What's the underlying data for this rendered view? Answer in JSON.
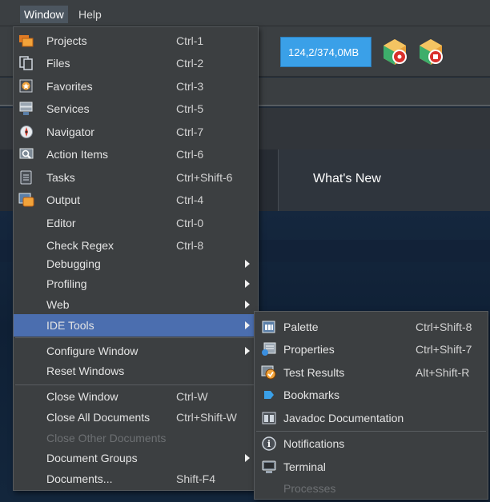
{
  "menubar": {
    "items": [
      {
        "label": "Window",
        "active": true
      },
      {
        "label": "Help",
        "active": false
      }
    ]
  },
  "toolbar": {
    "memory_label": "124,2/374,0MB",
    "profile_icons": [
      "profile-ide-icon",
      "profile-snapshot-icon"
    ]
  },
  "editor": {
    "whats_new_tab": "What's New"
  },
  "window_menu": {
    "items": [
      {
        "label": "Projects",
        "shortcut": "Ctrl-1",
        "icon": "projects-icon"
      },
      {
        "label": "Files",
        "shortcut": "Ctrl-2",
        "icon": "files-icon"
      },
      {
        "label": "Favorites",
        "shortcut": "Ctrl-3",
        "icon": "favorites-icon"
      },
      {
        "label": "Services",
        "shortcut": "Ctrl-5",
        "icon": "services-icon"
      },
      {
        "label": "Navigator",
        "shortcut": "Ctrl-7",
        "icon": "navigator-icon"
      },
      {
        "label": "Action Items",
        "shortcut": "Ctrl-6",
        "icon": "action-items-icon"
      },
      {
        "label": "Tasks",
        "shortcut": "Ctrl+Shift-6",
        "icon": "tasks-icon"
      },
      {
        "label": "Output",
        "shortcut": "Ctrl-4",
        "icon": "output-icon"
      },
      {
        "label": "Editor",
        "shortcut": "Ctrl-0"
      },
      {
        "label": "Check Regex",
        "shortcut": "Ctrl-8"
      },
      {
        "label": "Debugging",
        "submenu": true
      },
      {
        "label": "Profiling",
        "submenu": true
      },
      {
        "label": "Web",
        "submenu": true
      },
      {
        "label": "IDE Tools",
        "submenu": true,
        "selected": true
      },
      {
        "label": "Configure Window",
        "submenu": true
      },
      {
        "label": "Reset Windows"
      },
      {
        "label": "Close Window",
        "shortcut": "Ctrl-W"
      },
      {
        "label": "Close All Documents",
        "shortcut": "Ctrl+Shift-W"
      },
      {
        "label": "Close Other Documents",
        "disabled": true
      },
      {
        "label": "Document Groups",
        "submenu": true
      },
      {
        "label": "Documents...",
        "shortcut": "Shift-F4"
      }
    ]
  },
  "ide_tools_menu": {
    "items": [
      {
        "label": "Palette",
        "shortcut": "Ctrl+Shift-8",
        "icon": "palette-icon"
      },
      {
        "label": "Properties",
        "shortcut": "Ctrl+Shift-7",
        "icon": "properties-icon"
      },
      {
        "label": "Test Results",
        "shortcut": "Alt+Shift-R",
        "icon": "test-results-icon"
      },
      {
        "label": "Bookmarks",
        "icon": "bookmarks-icon"
      },
      {
        "label": "Javadoc Documentation",
        "icon": "javadoc-icon"
      },
      {
        "label": "Notifications",
        "icon": "notifications-icon"
      },
      {
        "label": "Terminal",
        "icon": "terminal-icon"
      },
      {
        "label": "Processes",
        "disabled": true
      }
    ]
  }
}
